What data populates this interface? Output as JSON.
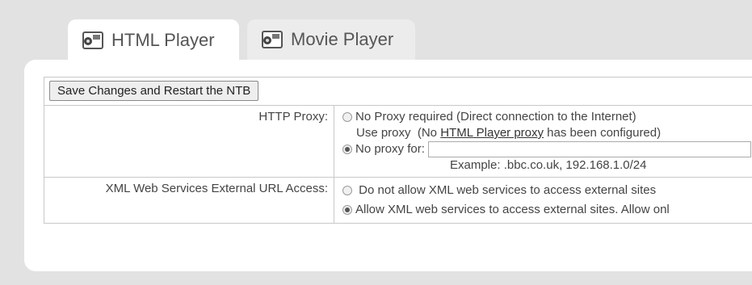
{
  "tabs": [
    {
      "label": "HTML Player",
      "icon": "player-window-icon",
      "active": true
    },
    {
      "label": "Movie Player",
      "icon": "player-window-icon",
      "active": false
    }
  ],
  "toolbar": {
    "save_label": "Save Changes and Restart the NTB"
  },
  "http_proxy": {
    "label": "HTTP Proxy:",
    "options": {
      "no_proxy_required": "No Proxy required (Direct connection to the Internet)",
      "use_proxy_prefix": "Use proxy  (No ",
      "use_proxy_link": "HTML Player proxy",
      "use_proxy_suffix": " has been configured)",
      "no_proxy_for": "No proxy for:"
    },
    "selected": "no_proxy_for",
    "no_proxy_for_value": "",
    "example": "Example: .bbc.co.uk, 192.168.1.0/24"
  },
  "xml_access": {
    "label": "XML Web Services External URL Access:",
    "options": [
      "Do not allow XML web services to access external sites",
      "Allow XML web services to access external sites. Allow onl"
    ],
    "selected_index": 1
  }
}
